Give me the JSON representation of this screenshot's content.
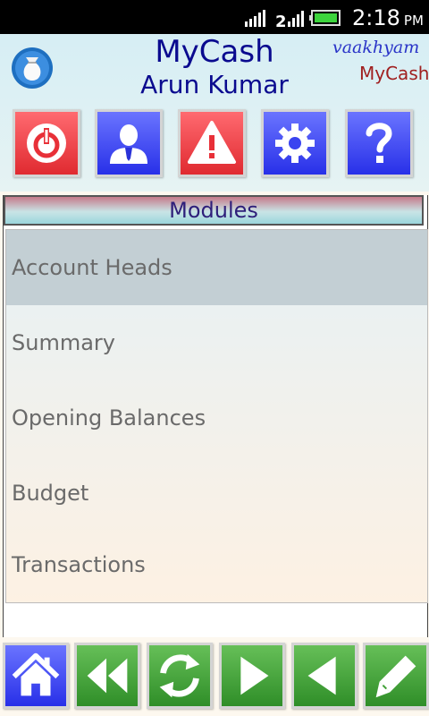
{
  "status_bar": {
    "network_type": "2",
    "time": "2:18",
    "ampm": "PM",
    "icons": [
      "signal-icon",
      "network-2g-icon",
      "battery-icon"
    ]
  },
  "header": {
    "app_title": "MyCash",
    "user_name": "Arun Kumar",
    "brand_script": "vaakhyam",
    "brand_name": "MyCash",
    "logo_icon": "money-bag-icon"
  },
  "toolbar": [
    {
      "icon": "power-icon",
      "color": "#e83038"
    },
    {
      "icon": "user-icon",
      "color": "#3a44f0"
    },
    {
      "icon": "warning-icon",
      "color": "#e83038"
    },
    {
      "icon": "gear-icon",
      "color": "#3a44f0"
    },
    {
      "icon": "help-icon",
      "color": "#3a44f0"
    }
  ],
  "modules": {
    "title": "Modules",
    "items": [
      {
        "label": "Account Heads",
        "selected": true
      },
      {
        "label": "Summary"
      },
      {
        "label": "Opening Balances"
      },
      {
        "label": "Budget"
      },
      {
        "label": "Transactions"
      }
    ]
  },
  "bottom_nav": [
    {
      "icon": "home-icon",
      "color": "#3a44f0"
    },
    {
      "icon": "rewind-icon",
      "color": "#3fa035"
    },
    {
      "icon": "refresh-icon",
      "color": "#3fa035"
    },
    {
      "icon": "play-icon",
      "color": "#3fa035"
    },
    {
      "icon": "back-icon",
      "color": "#3fa035"
    },
    {
      "icon": "edit-icon",
      "color": "#3fa035"
    }
  ]
}
